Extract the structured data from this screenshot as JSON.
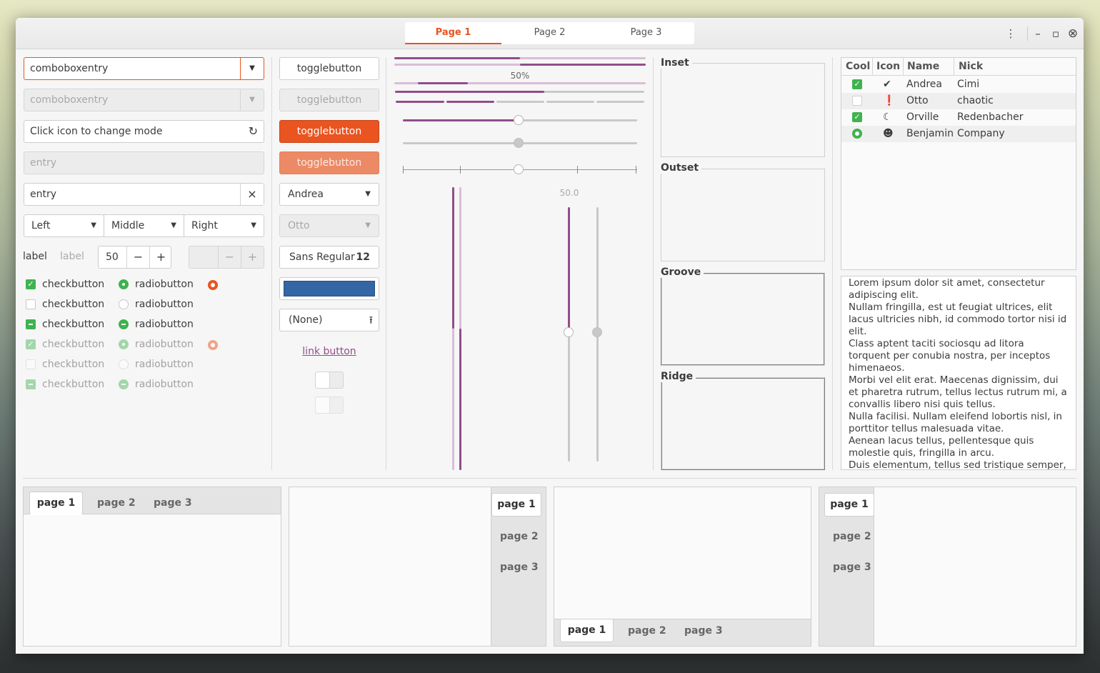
{
  "header": {
    "tabs": [
      "Page 1",
      "Page 2",
      "Page 3"
    ],
    "menu_icon": "⋮",
    "minimize_icon": "–",
    "maximize_icon": "▫",
    "close_icon": "⊗"
  },
  "col1": {
    "combo_entry_value": "comboboxentry",
    "combo_entry_disabled_value": "comboboxentry",
    "icon_entry_value": "Click icon to change mode",
    "entry_disabled_placeholder": "entry",
    "entry_value": "entry",
    "clear_icon": "×",
    "refresh_icon": "↻",
    "linked_combo": [
      "Left",
      "Middle",
      "Right"
    ],
    "label": "label",
    "label_disabled": "label",
    "spin_value": "50",
    "spin_minus": "−",
    "spin_plus": "+",
    "checkbuttons": [
      "checkbutton",
      "checkbutton",
      "checkbutton",
      "checkbutton",
      "checkbutton",
      "checkbutton"
    ],
    "radiobuttons": [
      "radiobutton",
      "radiobutton",
      "radiobutton",
      "radiobutton",
      "radiobutton",
      "radiobutton"
    ],
    "check_mark": "✓"
  },
  "col2": {
    "togglebuttons": [
      "togglebutton",
      "togglebutton",
      "togglebutton",
      "togglebutton"
    ],
    "combo_value": "Andrea",
    "combo_disabled_value": "Otto",
    "font_name": "Sans Regular",
    "font_size": "12",
    "color_swatch": "#3465a4",
    "file_chooser_value": "(None)",
    "upload_icon": "⭱",
    "link_button": "link button"
  },
  "col3": {
    "progress_text": "50%",
    "scale_value": "50.0",
    "progress_fraction": 0.5
  },
  "frames": [
    "Inset",
    "Outset",
    "Groove",
    "Ridge"
  ],
  "treeview": {
    "columns": [
      "Cool",
      "Icon",
      "Name",
      "Nick"
    ],
    "rows": [
      {
        "name": "Andrea",
        "nick": "Cimi",
        "icon": "✔"
      },
      {
        "name": "Otto",
        "nick": "chaotic",
        "icon": "❗"
      },
      {
        "name": "Orville",
        "nick": "Redenbacher",
        "icon": "☾"
      },
      {
        "name": "Benjamin",
        "nick": "Company",
        "icon": "☻"
      }
    ]
  },
  "textview": {
    "lines": [
      "Lorem ipsum dolor sit amet, consectetur",
      "adipiscing elit.",
      "Nullam fringilla, est ut feugiat ultrices, elit",
      "lacus ultricies nibh, id commodo tortor nisi id",
      "elit.",
      "Class aptent taciti sociosqu ad litora",
      "torquent per conubia nostra, per inceptos",
      "himenaeos.",
      "Morbi vel elit erat. Maecenas dignissim, dui",
      "et pharetra rutrum, tellus lectus rutrum mi, a",
      "convallis libero nisi quis tellus.",
      "Nulla facilisi. Nullam eleifend lobortis nisl, in",
      "porttitor tellus malesuada vitae.",
      "Aenean lacus tellus, pellentesque quis",
      "molestie quis, fringilla in arcu.",
      "Duis elementum, tellus sed tristique semper,"
    ]
  },
  "notebooks": {
    "tabs": [
      "page 1",
      "page 2",
      "page 3"
    ]
  },
  "colors": {
    "accent": "#e95420",
    "purple": "#924d8b",
    "green": "#3eb34f"
  }
}
